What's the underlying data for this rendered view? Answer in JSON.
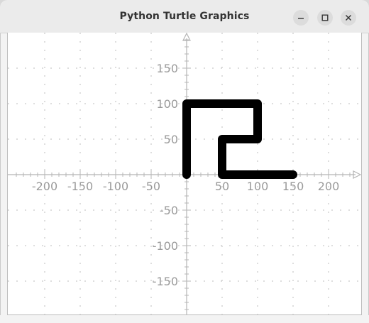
{
  "window": {
    "title": "Python Turtle Graphics",
    "buttons": {
      "minimize": "minimize-icon",
      "maximize": "maximize-icon",
      "close": "close-icon"
    }
  },
  "chart_data": {
    "type": "line",
    "xlim": [
      -250,
      250
    ],
    "ylim": [
      -195,
      195
    ],
    "grid": true,
    "x_ticks": [
      "-200",
      "-150",
      "-100",
      "-50",
      "50",
      "100",
      "150",
      "200"
    ],
    "y_ticks": [
      "150",
      "100",
      "50",
      "-50",
      "-100",
      "-150"
    ],
    "series": [
      {
        "values": [
          [
            0,
            0
          ],
          [
            0,
            100
          ],
          [
            100,
            100
          ],
          [
            100,
            50
          ],
          [
            50,
            50
          ],
          [
            50,
            0
          ],
          [
            150,
            0
          ]
        ]
      }
    ]
  },
  "colors": {
    "path": "#000000",
    "axis": "#b5b5b5",
    "grid": "#bdbdbd",
    "tick_label": "#9a9a9a"
  }
}
